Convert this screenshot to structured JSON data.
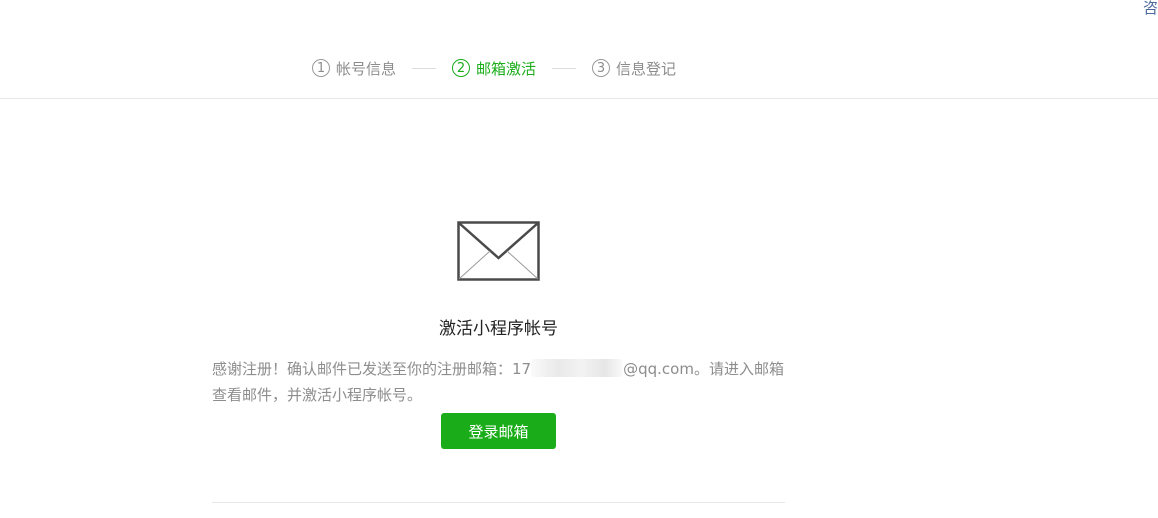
{
  "header": {
    "corner_text": "咨"
  },
  "steps": [
    {
      "num": "1",
      "label": "帐号信息",
      "state": "done"
    },
    {
      "num": "2",
      "label": "邮箱激活",
      "state": "active"
    },
    {
      "num": "3",
      "label": "信息登记",
      "state": "pending"
    }
  ],
  "main": {
    "icon": "mail-envelope-icon",
    "title": "激活小程序帐号",
    "desc_prefix": "感谢注册！确认邮件已发送至你的注册邮箱：",
    "email_visible": "17",
    "email_suffix": "@qq.com",
    "desc_suffix": "。请进入邮箱查看邮件，并激活小程序帐号。",
    "login_button": "登录邮箱"
  },
  "colors": {
    "accent": "#1aad19",
    "muted": "#8d8d8d",
    "divider": "#e7e7eb"
  }
}
